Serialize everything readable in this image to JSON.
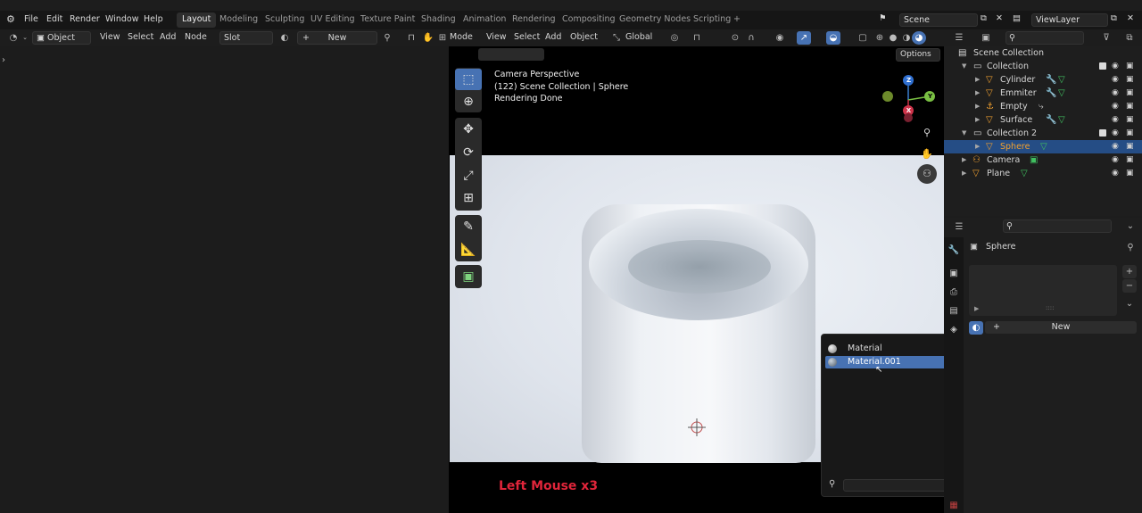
{
  "topbar": {
    "menus": [
      "File",
      "Edit",
      "Render",
      "Window",
      "Help"
    ],
    "workspaces": [
      "Layout",
      "Modeling",
      "Sculpting",
      "UV Editing",
      "Texture Paint",
      "Shading",
      "Animation",
      "Rendering",
      "Compositing",
      "Geometry Nodes",
      "Scripting"
    ],
    "active_workspace": "Layout",
    "add_workspace_symbol": "+",
    "scene": "Scene",
    "view_layer": "ViewLayer"
  },
  "node_header": {
    "editor_mode": "Object",
    "menus": [
      "View",
      "Select",
      "Add",
      "Node"
    ],
    "slot": "Slot",
    "new_label": "New",
    "plus": "+"
  },
  "viewport_header": {
    "mode": "Mode",
    "menus": [
      "View",
      "Select",
      "Add",
      "Object"
    ],
    "transform_orientation": "Global",
    "options": "Options"
  },
  "viewport": {
    "overlay_lines": [
      "Camera Perspective",
      "(122) Scene Collection | Sphere",
      "Rendering Done"
    ],
    "keycast": "Left Mouse x3",
    "gizmo_axes": [
      "Z",
      "Y",
      "X"
    ],
    "tools": [
      "select-box-tool",
      "cursor-tool",
      "move-tool",
      "rotate-tool",
      "scale-tool",
      "transform-tool",
      "annotate-tool",
      "measure-tool",
      "add-cube-tool"
    ]
  },
  "material_popup": {
    "options": [
      "Material",
      "Material.001"
    ],
    "selected": "Material.001",
    "search_placeholder": ""
  },
  "outliner": {
    "root": "Scene Collection",
    "rows": [
      {
        "label": "Collection",
        "type": "collection"
      },
      {
        "label": "Cylinder",
        "type": "mesh"
      },
      {
        "label": "Emmiter",
        "type": "mesh"
      },
      {
        "label": "Empty",
        "type": "empty"
      },
      {
        "label": "Surface",
        "type": "mesh"
      },
      {
        "label": "Collection 2",
        "type": "collection"
      },
      {
        "label": "Sphere",
        "type": "mesh"
      },
      {
        "label": "Camera",
        "type": "camera"
      },
      {
        "label": "Plane",
        "type": "mesh"
      }
    ],
    "selected": "Sphere"
  },
  "properties": {
    "object_name": "Sphere",
    "new_label": "New",
    "list_grip": "::::",
    "plus": "+",
    "minus": "−"
  },
  "colors": {
    "accent_blue": "#4772b3",
    "selection_row": "#254d85",
    "keycast_red": "#e0253a",
    "mesh_orange": "#f0a030",
    "modifier_green": "#40c060"
  }
}
